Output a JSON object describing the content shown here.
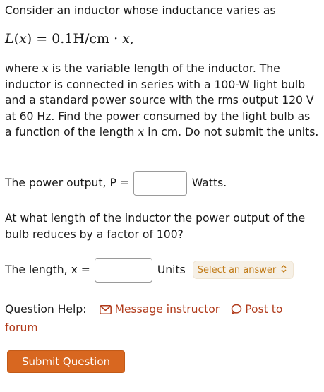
{
  "question": {
    "intro": "Consider an inductor whose inductance varies as",
    "formula": {
      "lhs_fn": "L",
      "lhs_var": "x",
      "rhs_prefix": "0.1H/cm · ",
      "rhs_var": "x",
      "rhs_suffix": ","
    },
    "desc_part1": "where ",
    "desc_var": "x",
    "desc_part2": " is the variable length of the inductor. The inductor is connected in series with a 100-W light bulb and a standard power source with the rms output 120 V at 60 Hz. Find the power consumed by the light bulb as a function of the length ",
    "desc_var2": "x",
    "desc_part3": " in cm. Do not submit the units."
  },
  "power_row": {
    "label": "The power output, P =",
    "unit": "Watts."
  },
  "question2": "At what length of the inductor the power output of the bulb reduces by a factor of 100?",
  "length_row": {
    "label": "The length, x =",
    "unit": "Units",
    "select_placeholder": "Select an answer"
  },
  "help": {
    "label": "Question Help:",
    "message_link": "Message instructor",
    "forum_link_part1": "Post to",
    "forum_link_part2": "forum"
  },
  "submit_label": "Submit Question",
  "icons": {
    "envelope": "envelope-icon",
    "speech_bubble": "speech-bubble-icon",
    "select_arrows": "select-arrows-icon"
  },
  "colors": {
    "link": "#b03a1a",
    "submit_bg": "#d86720",
    "select_text": "#c17a16",
    "select_bg": "#f6f0e6"
  }
}
